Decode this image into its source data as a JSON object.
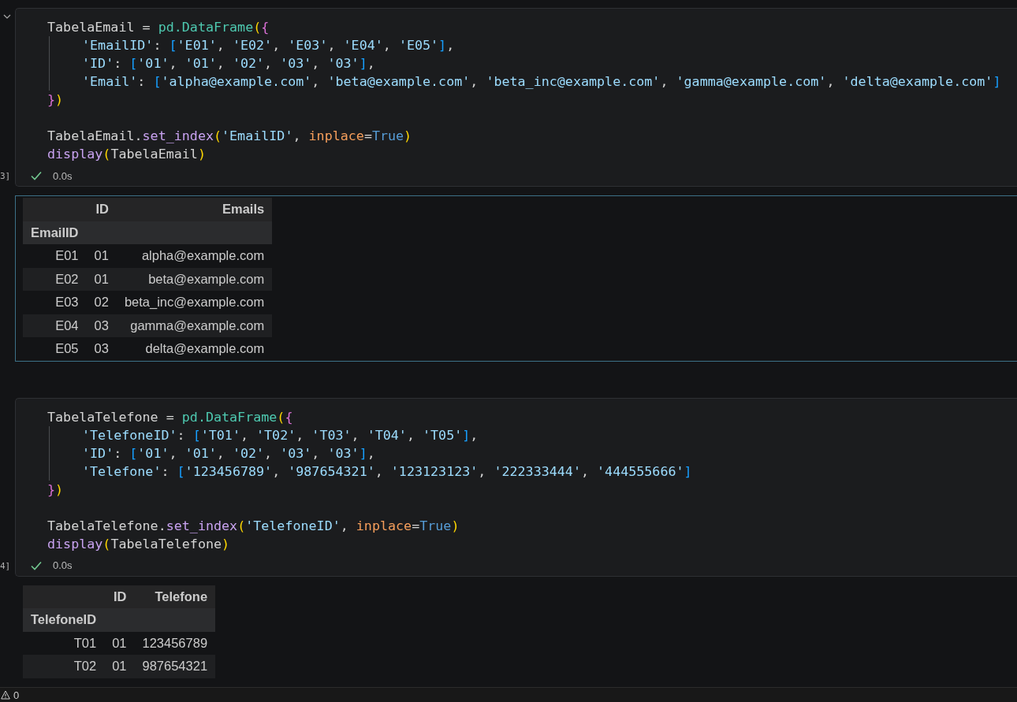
{
  "cells": [
    {
      "chevron": true,
      "execution_count": "3]",
      "time": "0.0s",
      "code": [
        [
          {
            "indented": false,
            "tokens": [
              {
                "kind": "plain",
                "text": "TabelaEmail = "
              },
              {
                "kind": "class",
                "text": "pd.DataFrame"
              },
              {
                "kind": "paren",
                "text": "("
              },
              {
                "kind": "brace",
                "text": "{"
              }
            ]
          },
          {
            "indented": true,
            "tokens": [
              {
                "kind": "string",
                "text": "'EmailID'"
              },
              {
                "kind": "plain",
                "text": ": "
              },
              {
                "kind": "bracket",
                "text": "["
              },
              {
                "kind": "string",
                "text": "'E01'"
              },
              {
                "kind": "plain",
                "text": ", "
              },
              {
                "kind": "string",
                "text": "'E02'"
              },
              {
                "kind": "plain",
                "text": ", "
              },
              {
                "kind": "string",
                "text": "'E03'"
              },
              {
                "kind": "plain",
                "text": ", "
              },
              {
                "kind": "string",
                "text": "'E04'"
              },
              {
                "kind": "plain",
                "text": ", "
              },
              {
                "kind": "string",
                "text": "'E05'"
              },
              {
                "kind": "bracket",
                "text": "]"
              },
              {
                "kind": "plain",
                "text": ","
              }
            ]
          },
          {
            "indented": true,
            "tokens": [
              {
                "kind": "string",
                "text": "'ID'"
              },
              {
                "kind": "plain",
                "text": ": "
              },
              {
                "kind": "bracket",
                "text": "["
              },
              {
                "kind": "string",
                "text": "'01'"
              },
              {
                "kind": "plain",
                "text": ", "
              },
              {
                "kind": "string",
                "text": "'01'"
              },
              {
                "kind": "plain",
                "text": ", "
              },
              {
                "kind": "string",
                "text": "'02'"
              },
              {
                "kind": "plain",
                "text": ", "
              },
              {
                "kind": "string",
                "text": "'03'"
              },
              {
                "kind": "plain",
                "text": ", "
              },
              {
                "kind": "string",
                "text": "'03'"
              },
              {
                "kind": "bracket",
                "text": "]"
              },
              {
                "kind": "plain",
                "text": ","
              }
            ]
          },
          {
            "indented": true,
            "tokens": [
              {
                "kind": "string",
                "text": "'Email'"
              },
              {
                "kind": "plain",
                "text": ": "
              },
              {
                "kind": "bracket",
                "text": "["
              },
              {
                "kind": "string",
                "text": "'alpha@example.com'"
              },
              {
                "kind": "plain",
                "text": ", "
              },
              {
                "kind": "string",
                "text": "'beta@example.com'"
              },
              {
                "kind": "plain",
                "text": ", "
              },
              {
                "kind": "string",
                "text": "'beta_inc@example.com'"
              },
              {
                "kind": "plain",
                "text": ", "
              },
              {
                "kind": "string",
                "text": "'gamma@example.com'"
              },
              {
                "kind": "plain",
                "text": ", "
              },
              {
                "kind": "string",
                "text": "'delta@example.com'"
              },
              {
                "kind": "bracket",
                "text": "]"
              }
            ]
          },
          {
            "indented": false,
            "tokens": [
              {
                "kind": "brace",
                "text": "}"
              },
              {
                "kind": "paren",
                "text": ")"
              }
            ]
          }
        ],
        [
          {
            "indented": false,
            "tokens": [
              {
                "kind": "plain",
                "text": "TabelaEmail."
              },
              {
                "kind": "method",
                "text": "set_index"
              },
              {
                "kind": "paren",
                "text": "("
              },
              {
                "kind": "string",
                "text": "'EmailID'"
              },
              {
                "kind": "plain",
                "text": ", "
              },
              {
                "kind": "param",
                "text": "inplace"
              },
              {
                "kind": "plain",
                "text": "="
              },
              {
                "kind": "keyword",
                "text": "True"
              },
              {
                "kind": "paren",
                "text": ")"
              }
            ]
          },
          {
            "indented": false,
            "tokens": [
              {
                "kind": "method",
                "text": "display"
              },
              {
                "kind": "paren",
                "text": "("
              },
              {
                "kind": "plain",
                "text": "TabelaEmail"
              },
              {
                "kind": "paren",
                "text": ")"
              }
            ]
          }
        ]
      ],
      "output": {
        "focused": true,
        "index_name": "EmailID",
        "columns": [
          "ID",
          "Emails"
        ],
        "rows": [
          {
            "index": "E01",
            "values": [
              "01",
              "alpha@example.com"
            ]
          },
          {
            "index": "E02",
            "values": [
              "01",
              "beta@example.com"
            ]
          },
          {
            "index": "E03",
            "values": [
              "02",
              "beta_inc@example.com"
            ]
          },
          {
            "index": "E04",
            "values": [
              "03",
              "gamma@example.com"
            ]
          },
          {
            "index": "E05",
            "values": [
              "03",
              "delta@example.com"
            ]
          }
        ]
      }
    },
    {
      "chevron": false,
      "execution_count": "4]",
      "time": "0.0s",
      "code": [
        [
          {
            "indented": false,
            "tokens": [
              {
                "kind": "plain",
                "text": "TabelaTelefone = "
              },
              {
                "kind": "class",
                "text": "pd.DataFrame"
              },
              {
                "kind": "paren",
                "text": "("
              },
              {
                "kind": "brace",
                "text": "{"
              }
            ]
          },
          {
            "indented": true,
            "tokens": [
              {
                "kind": "string",
                "text": "'TelefoneID'"
              },
              {
                "kind": "plain",
                "text": ": "
              },
              {
                "kind": "bracket",
                "text": "["
              },
              {
                "kind": "string",
                "text": "'T01'"
              },
              {
                "kind": "plain",
                "text": ", "
              },
              {
                "kind": "string",
                "text": "'T02'"
              },
              {
                "kind": "plain",
                "text": ", "
              },
              {
                "kind": "string",
                "text": "'T03'"
              },
              {
                "kind": "plain",
                "text": ", "
              },
              {
                "kind": "string",
                "text": "'T04'"
              },
              {
                "kind": "plain",
                "text": ", "
              },
              {
                "kind": "string",
                "text": "'T05'"
              },
              {
                "kind": "bracket",
                "text": "]"
              },
              {
                "kind": "plain",
                "text": ","
              }
            ]
          },
          {
            "indented": true,
            "tokens": [
              {
                "kind": "string",
                "text": "'ID'"
              },
              {
                "kind": "plain",
                "text": ": "
              },
              {
                "kind": "bracket",
                "text": "["
              },
              {
                "kind": "string",
                "text": "'01'"
              },
              {
                "kind": "plain",
                "text": ", "
              },
              {
                "kind": "string",
                "text": "'01'"
              },
              {
                "kind": "plain",
                "text": ", "
              },
              {
                "kind": "string",
                "text": "'02'"
              },
              {
                "kind": "plain",
                "text": ", "
              },
              {
                "kind": "string",
                "text": "'03'"
              },
              {
                "kind": "plain",
                "text": ", "
              },
              {
                "kind": "string",
                "text": "'03'"
              },
              {
                "kind": "bracket",
                "text": "]"
              },
              {
                "kind": "plain",
                "text": ","
              }
            ]
          },
          {
            "indented": true,
            "tokens": [
              {
                "kind": "string",
                "text": "'Telefone'"
              },
              {
                "kind": "plain",
                "text": ": "
              },
              {
                "kind": "bracket",
                "text": "["
              },
              {
                "kind": "string",
                "text": "'123456789'"
              },
              {
                "kind": "plain",
                "text": ", "
              },
              {
                "kind": "string",
                "text": "'987654321'"
              },
              {
                "kind": "plain",
                "text": ", "
              },
              {
                "kind": "string",
                "text": "'123123123'"
              },
              {
                "kind": "plain",
                "text": ", "
              },
              {
                "kind": "string",
                "text": "'222333444'"
              },
              {
                "kind": "plain",
                "text": ", "
              },
              {
                "kind": "string",
                "text": "'444555666'"
              },
              {
                "kind": "bracket",
                "text": "]"
              }
            ]
          },
          {
            "indented": false,
            "tokens": [
              {
                "kind": "brace",
                "text": "}"
              },
              {
                "kind": "paren",
                "text": ")"
              }
            ]
          }
        ],
        [
          {
            "indented": false,
            "tokens": [
              {
                "kind": "plain",
                "text": "TabelaTelefone."
              },
              {
                "kind": "method",
                "text": "set_index"
              },
              {
                "kind": "paren",
                "text": "("
              },
              {
                "kind": "string",
                "text": "'TelefoneID'"
              },
              {
                "kind": "plain",
                "text": ", "
              },
              {
                "kind": "param",
                "text": "inplace"
              },
              {
                "kind": "plain",
                "text": "="
              },
              {
                "kind": "keyword",
                "text": "True"
              },
              {
                "kind": "paren",
                "text": ")"
              }
            ]
          },
          {
            "indented": false,
            "tokens": [
              {
                "kind": "method",
                "text": "display"
              },
              {
                "kind": "paren",
                "text": "("
              },
              {
                "kind": "plain",
                "text": "TabelaTelefone"
              },
              {
                "kind": "paren",
                "text": ")"
              }
            ]
          }
        ]
      ],
      "output": {
        "focused": false,
        "index_name": "TelefoneID",
        "columns": [
          "ID",
          "Telefone"
        ],
        "rows": [
          {
            "index": "T01",
            "values": [
              "01",
              "123456789"
            ]
          },
          {
            "index": "T02",
            "values": [
              "01",
              "987654321"
            ]
          }
        ]
      }
    }
  ],
  "status_bar": {
    "warnings": "0"
  }
}
